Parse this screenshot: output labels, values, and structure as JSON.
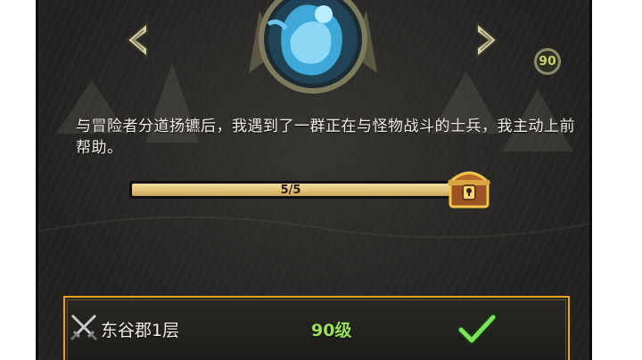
{
  "chapter": {
    "level": "90",
    "story_text": "与冒险者分道扬镳后，我遇到了一群正在与怪物战斗的士兵，我主动上前帮助。"
  },
  "progress": {
    "label": "5/5",
    "current": 5,
    "total": 5,
    "fraction": 1.0
  },
  "stage": {
    "name": "东谷郡1层",
    "level_req": "90级",
    "completed": true
  },
  "icons": {
    "prev": "chevron-left-icon",
    "next": "chevron-right-icon",
    "chest": "treasure-chest-icon",
    "swords": "crossed-swords-icon",
    "check": "checkmark-icon"
  },
  "colors": {
    "accent_gold": "#e6a31a",
    "level_green": "#9be05a",
    "progress_fill": "#e2c27a",
    "panel_bg": "#232221"
  }
}
